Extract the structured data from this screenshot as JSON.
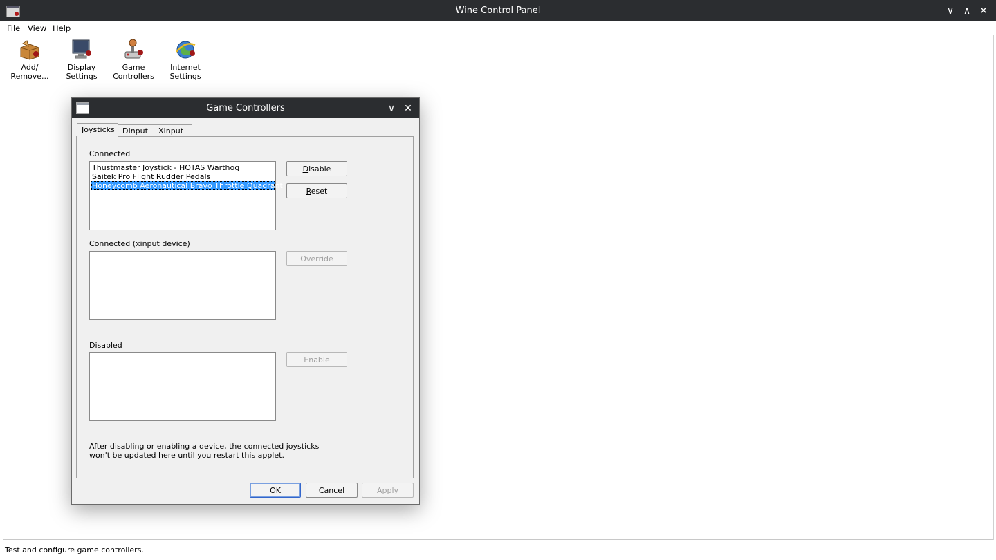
{
  "window": {
    "title": "Wine Control Panel",
    "controls": {
      "minimize": "∨",
      "maximize": "∧",
      "close": "✕"
    }
  },
  "menu": {
    "items": [
      "File",
      "View",
      "Help"
    ]
  },
  "applets": [
    {
      "label": "Add/\nRemove...",
      "icon": "add-remove-programs-icon"
    },
    {
      "label": "Display\nSettings",
      "icon": "display-settings-icon"
    },
    {
      "label": "Game\nControllers",
      "icon": "game-controllers-icon"
    },
    {
      "label": "Internet\nSettings",
      "icon": "internet-settings-icon"
    }
  ],
  "status": {
    "text": "Test and configure game controllers."
  },
  "dialog": {
    "title": "Game Controllers",
    "controls": {
      "minimize": "∨",
      "close": "✕"
    },
    "tabs": [
      "Joysticks",
      "DInput",
      "XInput"
    ],
    "connected_label": "Connected",
    "connected_items": [
      "Thustmaster Joystick - HOTAS Warthog",
      "Saitek Pro Flight Rudder Pedals",
      "Honeycomb Aeronautical Bravo Throttle Quadrant"
    ],
    "selected_index": 2,
    "disable_label": "Disable",
    "reset_label": "Reset",
    "xinput_label": "Connected (xinput device)",
    "override_label": "Override",
    "disabled_label": "Disabled",
    "enable_label": "Enable",
    "note": "After disabling or enabling a device, the connected joysticks\nwon't be updated here until you restart this applet.",
    "ok_label": "OK",
    "cancel_label": "Cancel",
    "apply_label": "Apply"
  }
}
